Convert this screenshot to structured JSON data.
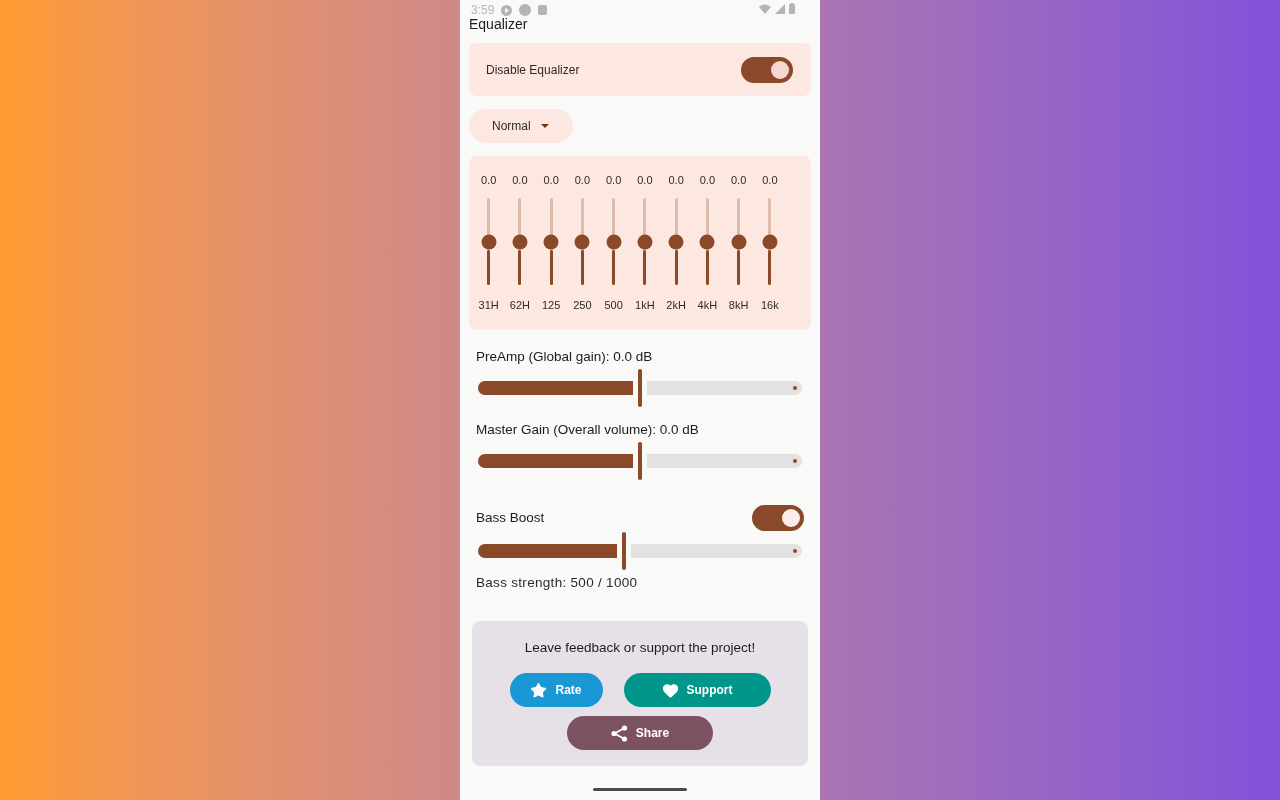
{
  "status_bar": {
    "time": "3:59"
  },
  "title": "Equalizer",
  "disable_equalizer": {
    "label": "Disable Equalizer",
    "on": true
  },
  "preset": {
    "value": "Normal"
  },
  "bands": [
    {
      "value": "0.0",
      "label": "31H",
      "level": 0.5
    },
    {
      "value": "0.0",
      "label": "62H",
      "level": 0.5
    },
    {
      "value": "0.0",
      "label": "125",
      "level": 0.5
    },
    {
      "value": "0.0",
      "label": "250",
      "level": 0.5
    },
    {
      "value": "0.0",
      "label": "500",
      "level": 0.5
    },
    {
      "value": "0.0",
      "label": "1kH",
      "level": 0.5
    },
    {
      "value": "0.0",
      "label": "2kH",
      "level": 0.5
    },
    {
      "value": "0.0",
      "label": "4kH",
      "level": 0.5
    },
    {
      "value": "0.0",
      "label": "8kH",
      "level": 0.5
    },
    {
      "value": "0.0",
      "label": "16k",
      "level": 0.5
    }
  ],
  "preamp": {
    "label": "PreAmp (Global gain): 0.0 dB",
    "level": 0.5
  },
  "master_gain": {
    "label": "Master Gain (Overall volume): 0.0 dB",
    "level": 0.5
  },
  "bass_boost": {
    "label": "Bass Boost",
    "on": true,
    "level": 0.45,
    "reading": "Bass strength: 500 / 1000"
  },
  "feedback": {
    "message": "Leave feedback or support the project!",
    "buttons": [
      {
        "kind": "rate",
        "label": "Rate"
      },
      {
        "kind": "support",
        "label": "Support"
      },
      {
        "kind": "share",
        "label": "Share"
      }
    ]
  }
}
